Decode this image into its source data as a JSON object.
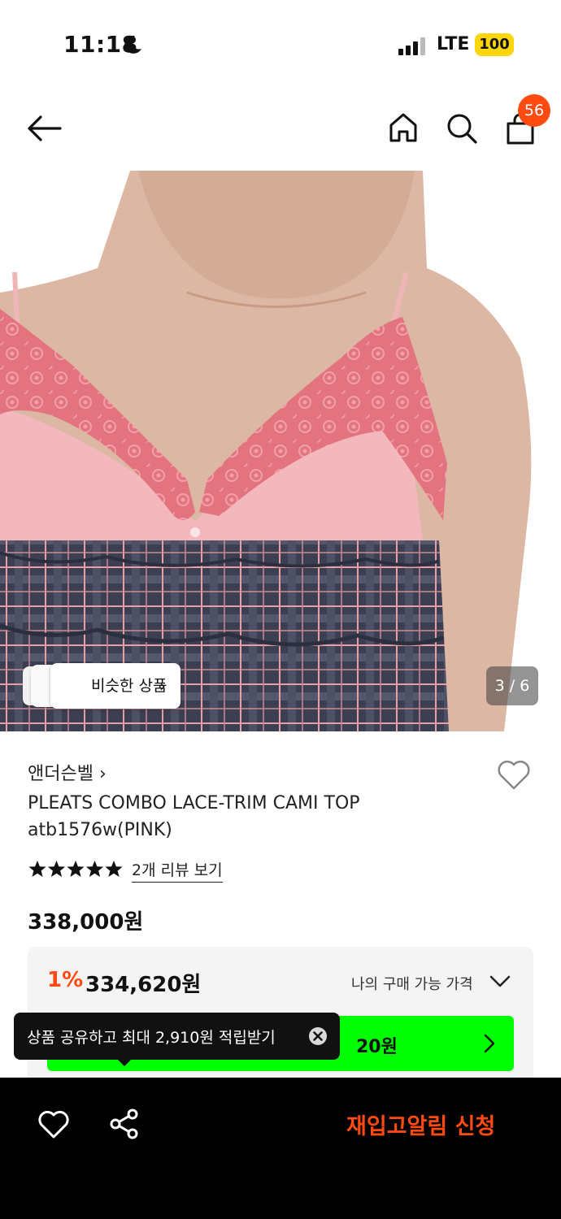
{
  "status_bar": {
    "time": "11:18",
    "network": "LTE",
    "battery": "100",
    "icons": [
      "moon-icon",
      "signal-icon"
    ]
  },
  "nav": {
    "icons": [
      "back-arrow-icon",
      "home-icon",
      "search-icon",
      "shopping-bag-icon"
    ],
    "cart_count": "56"
  },
  "gallery": {
    "similar_label": "비슷한 상품",
    "similar_chevron": "›",
    "page_indicator": "3 / 6"
  },
  "product": {
    "brand": "앤더슨벨 ›",
    "title_line1": "PLEATS COMBO LACE-TRIM CAMI TOP",
    "title_line2": "atb1576w(PINK)",
    "rating_stars": 5,
    "review_link": "2개 리뷰 보기",
    "price": "338,000원"
  },
  "price_box": {
    "discount_rate": "1%",
    "discount_price": "334,620원",
    "my_price_label": "나의 구매 가능 가격",
    "promo_partial": "20원"
  },
  "tooltip": {
    "text": "상품 공유하고 최대 2,910원 적립받기"
  },
  "bottom_bar": {
    "restock_label": "재입고알림 신청"
  },
  "colors": {
    "accent": "#ff4b12",
    "green": "#00ff00",
    "battery": "#ffd60a"
  }
}
